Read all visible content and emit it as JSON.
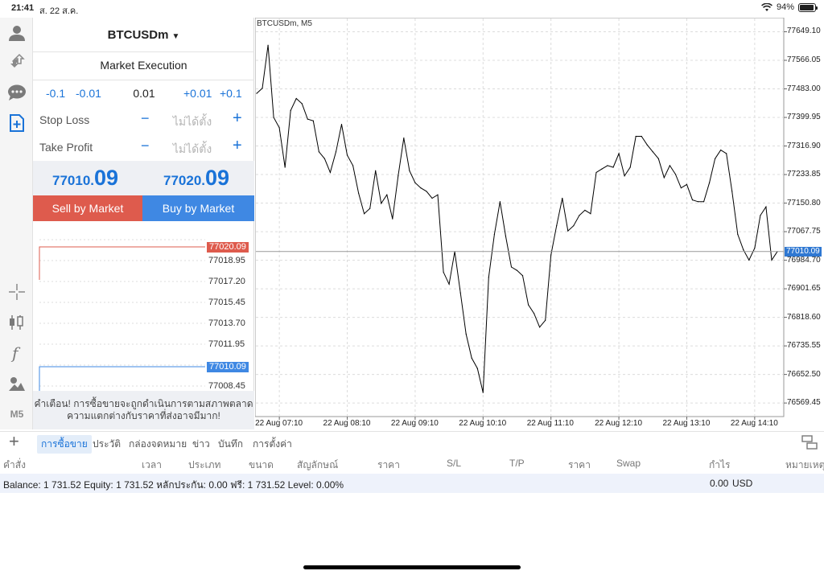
{
  "status_bar": {
    "time": "21:41",
    "date": "ส. 22 ส.ค.",
    "battery": "94%"
  },
  "toolbar": {
    "icons": [
      "account-icon",
      "deposit-withdraw-icon",
      "chat-icon",
      "new-order-icon",
      "crosshair-icon",
      "chart-type-icon",
      "indicators-icon",
      "objects-icon"
    ],
    "timeframe": "M5"
  },
  "trade": {
    "symbol": "BTCUSDm",
    "execution": "Market Execution",
    "volume": {
      "minus_big": "-0.1",
      "minus_small": "-0.01",
      "value": "0.01",
      "plus_small": "+0.01",
      "plus_big": "+0.1"
    },
    "stop_loss": {
      "label": "Stop Loss",
      "minus": "−",
      "value": "ไม่ได้ตั้ง",
      "plus": "+"
    },
    "take_profit": {
      "label": "Take Profit",
      "minus": "−",
      "value": "ไม่ได้ตั้ง",
      "plus": "+"
    },
    "bid": {
      "main": "77010.",
      "big": "09"
    },
    "ask": {
      "main": "77020.",
      "big": "09"
    },
    "sell_label": "Sell by Market",
    "buy_label": "Buy by Market",
    "mini_chart": {
      "ask_tag": "77020.09",
      "bid_tag": "77010.09",
      "levels": [
        "77018.95",
        "77017.20",
        "77015.45",
        "77013.70",
        "77011.95",
        "77008.45"
      ]
    },
    "warning_line1": "คำเตือน! การซื้อขายจะถูกดำเนินการตามสภาพตลาด",
    "warning_line2": "ความแตกต่างกับราคาที่ส่งอาจมีมาก!"
  },
  "chart": {
    "title": "BTCUSDm, M5",
    "current_price": "77010.09",
    "y_ticks": [
      "77649.10",
      "77566.05",
      "77483.00",
      "77399.95",
      "77316.90",
      "77233.85",
      "77150.80",
      "77067.75",
      "76984.70",
      "76901.65",
      "76818.60",
      "76735.55",
      "76652.50",
      "76569.45"
    ],
    "x_ticks": [
      "22 Aug 07:10",
      "22 Aug 08:10",
      "22 Aug 09:10",
      "22 Aug 10:10",
      "22 Aug 11:10",
      "22 Aug 12:10",
      "22 Aug 13:10",
      "22 Aug 14:10"
    ],
    "line_color": "#000000",
    "bid_color": "#2f78d2",
    "ask_color": "#de5b4d"
  },
  "chart_data": {
    "type": "line",
    "title": "BTCUSDm, M5",
    "xlabel": "",
    "ylabel": "",
    "ylim": [
      76530,
      77690
    ],
    "x": [
      "06:50",
      "06:55",
      "07:00",
      "07:05",
      "07:10",
      "07:15",
      "07:20",
      "07:25",
      "07:30",
      "07:35",
      "07:40",
      "07:45",
      "07:50",
      "07:55",
      "08:00",
      "08:05",
      "08:10",
      "08:15",
      "08:20",
      "08:25",
      "08:30",
      "08:35",
      "08:40",
      "08:45",
      "08:50",
      "08:55",
      "09:00",
      "09:05",
      "09:10",
      "09:15",
      "09:20",
      "09:25",
      "09:30",
      "09:35",
      "09:40",
      "09:45",
      "09:50",
      "09:55",
      "10:00",
      "10:05",
      "10:10",
      "10:15",
      "10:20",
      "10:25",
      "10:30",
      "10:35",
      "10:40",
      "10:45",
      "10:50",
      "10:55",
      "11:00",
      "11:05",
      "11:10",
      "11:15",
      "11:20",
      "11:25",
      "11:30",
      "11:35",
      "11:40",
      "11:45",
      "11:50",
      "11:55",
      "12:00",
      "12:05",
      "12:10",
      "12:15",
      "12:20",
      "12:25",
      "12:30",
      "12:35",
      "12:40",
      "12:45",
      "12:50",
      "12:55",
      "13:00",
      "13:05",
      "13:10",
      "13:15",
      "13:20",
      "13:25",
      "13:30",
      "13:35",
      "13:40",
      "13:45",
      "13:50",
      "13:55",
      "14:00",
      "14:05",
      "14:10",
      "14:15"
    ],
    "values": [
      77470,
      77485,
      77610,
      77400,
      77370,
      77255,
      77420,
      77455,
      77440,
      77395,
      77390,
      77300,
      77280,
      77240,
      77300,
      77380,
      77290,
      77260,
      77180,
      77120,
      77135,
      77245,
      77150,
      77175,
      77105,
      77230,
      77340,
      77245,
      77210,
      77195,
      77185,
      77165,
      77175,
      76950,
      76915,
      77010,
      76890,
      76770,
      76700,
      76670,
      76600,
      76935,
      77060,
      77155,
      77055,
      76965,
      76955,
      76940,
      76855,
      76830,
      76790,
      76810,
      77000,
      77085,
      77165,
      77070,
      77085,
      77115,
      77130,
      77120,
      77240,
      77250,
      77260,
      77255,
      77295,
      77230,
      77255,
      77345,
      77345,
      77320,
      77300,
      77280,
      77225,
      77260,
      77235,
      77195,
      77205,
      77160,
      77155,
      77155,
      77210,
      77280,
      77305,
      77295,
      77185,
      77060,
      77015,
      76985,
      77020,
      77115,
      77140,
      76985,
      77010
    ],
    "grid": true
  },
  "tabs": {
    "add": "+",
    "items": [
      "การซื้อขาย",
      "ประวัติ",
      "กล่องจดหมาย",
      "ข่าว",
      "บันทึก",
      "การตั้งค่า"
    ]
  },
  "table": {
    "headers": [
      "คำสั่ง",
      "เวลา",
      "ประเภท",
      "ขนาด",
      "สัญลักษณ์",
      "ราคา",
      "S/L",
      "T/P",
      "ราคา",
      "Swap",
      "กำไร",
      "หมายเหตุ"
    ]
  },
  "balance": {
    "text": "Balance: 1 731.52 Equity: 1 731.52 หลักประกัน: 0.00 ฟรี: 1 731.52 Level: 0.00%",
    "profit": "0.00",
    "currency": "USD"
  }
}
